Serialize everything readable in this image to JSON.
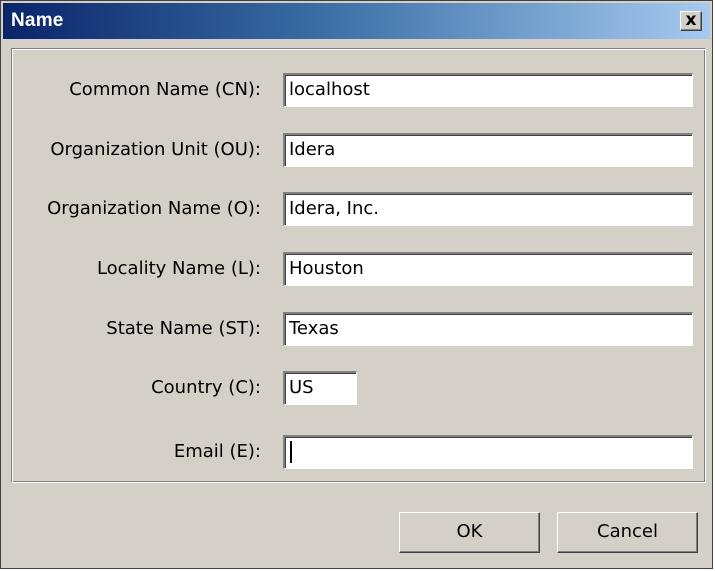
{
  "window": {
    "title": "Name",
    "close_glyph": "x"
  },
  "fields": [
    {
      "label": "Common Name (CN):",
      "value": "localhost"
    },
    {
      "label": "Organization Unit (OU):",
      "value": "Idera"
    },
    {
      "label": "Organization Name (O):",
      "value": "Idera, Inc."
    },
    {
      "label": "Locality Name (L):",
      "value": "Houston"
    },
    {
      "label": "State Name (ST):",
      "value": "Texas"
    },
    {
      "label": "Country (C):",
      "value": "US"
    },
    {
      "label": "Email (E):",
      "value": ""
    }
  ],
  "buttons": {
    "ok_label": "OK",
    "cancel_label": "Cancel"
  },
  "colors": {
    "titlebar_start": "#0a246a",
    "titlebar_end": "#a6caf0",
    "dialog_face": "#d4d0c8",
    "field_bg": "#ffffff"
  }
}
